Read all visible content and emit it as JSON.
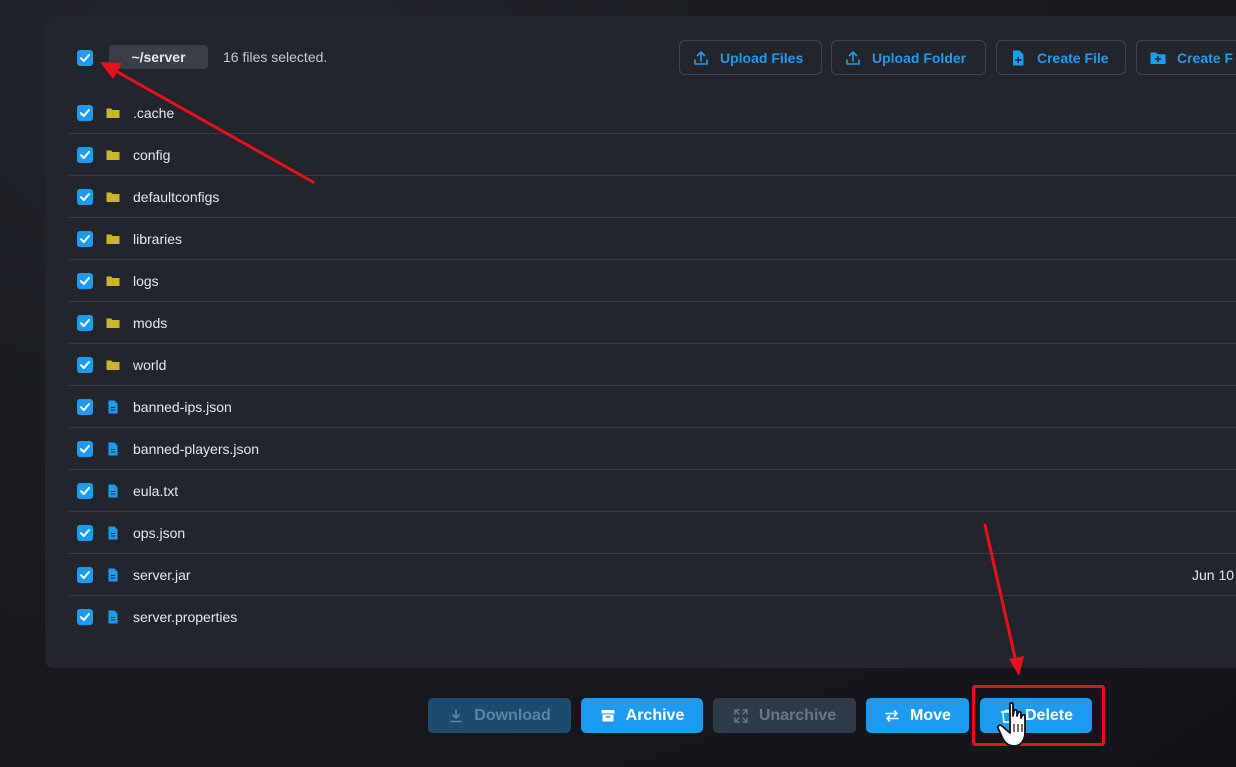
{
  "breadcrumb": "~/server",
  "selection_text": "16 files selected.",
  "toolbar": {
    "upload_files": "Upload Files",
    "upload_folder": "Upload Folder",
    "create_file": "Create File",
    "create_folder": "Create F"
  },
  "files": [
    {
      "name": ".cache",
      "type": "folder",
      "date": ""
    },
    {
      "name": "config",
      "type": "folder",
      "date": ""
    },
    {
      "name": "defaultconfigs",
      "type": "folder",
      "date": ""
    },
    {
      "name": "libraries",
      "type": "folder",
      "date": ""
    },
    {
      "name": "logs",
      "type": "folder",
      "date": ""
    },
    {
      "name": "mods",
      "type": "folder",
      "date": ""
    },
    {
      "name": "world",
      "type": "folder",
      "date": ""
    },
    {
      "name": "banned-ips.json",
      "type": "file",
      "date": ""
    },
    {
      "name": "banned-players.json",
      "type": "file",
      "date": ""
    },
    {
      "name": "eula.txt",
      "type": "file",
      "date": ""
    },
    {
      "name": "ops.json",
      "type": "file",
      "date": ""
    },
    {
      "name": "server.jar",
      "type": "file",
      "date": "Jun 10"
    },
    {
      "name": "server.properties",
      "type": "file",
      "date": ""
    }
  ],
  "actions": {
    "download": "Download",
    "archive": "Archive",
    "unarchive": "Unarchive",
    "move": "Move",
    "delete": "Delete"
  },
  "colors": {
    "accent": "#1e9bf0",
    "folder": "#c9b42a",
    "annotation": "#e8101a"
  }
}
